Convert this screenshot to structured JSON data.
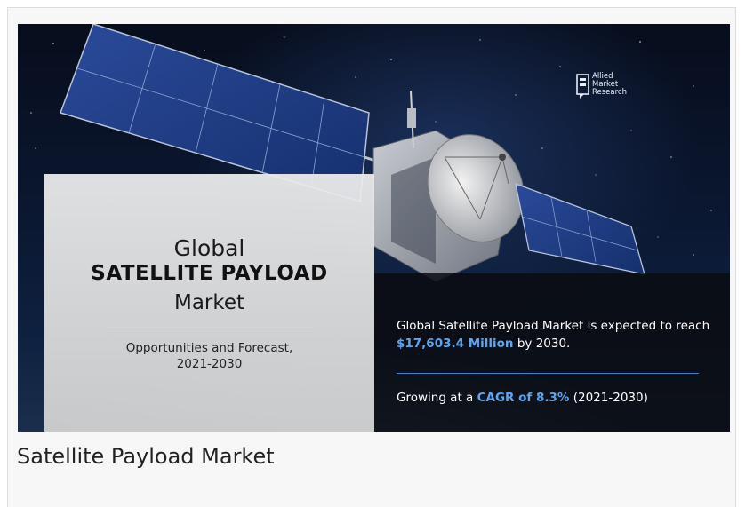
{
  "banner": {
    "logo": {
      "line1": "Allied",
      "line2": "Market",
      "line3": "Research"
    },
    "left_panel": {
      "line1": "Global",
      "line2": "SATELLITE PAYLOAD",
      "line3": "Market",
      "subtitle_line1": "Opportunities and Forecast,",
      "subtitle_line2": "2021-2030"
    },
    "right_panel": {
      "stat1_prefix": "Global Satellite Payload Market is expected to reach ",
      "stat1_highlight": "$17,603.4 Million",
      "stat1_suffix": " by 2030.",
      "stat2_prefix": "Growing at a ",
      "stat2_highlight": "CAGR of 8.3%",
      "stat2_suffix": " (2021-2030)"
    },
    "colors": {
      "highlight": "#5aa7f0",
      "rule": "#3a7ed0"
    }
  },
  "caption": "Satellite Payload Market"
}
